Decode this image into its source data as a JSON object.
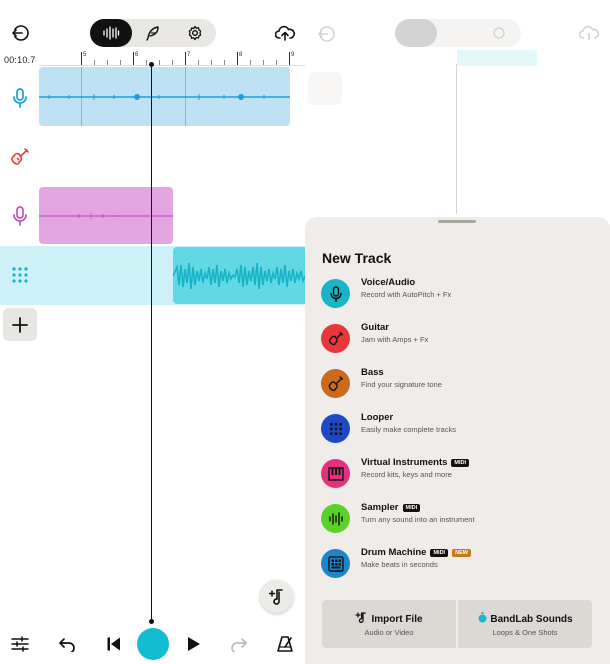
{
  "timeline": {
    "position": "00:10.7",
    "bars": [
      "5",
      "6",
      "7",
      "8",
      "9"
    ]
  },
  "toolbar": {
    "back_icon": "exit-icon",
    "segments": [
      "waveform-icon",
      "feather-icon",
      "gear-icon"
    ],
    "active_segment": "waveform-icon",
    "upload_icon": "cloud-upload-icon"
  },
  "tracks": [
    {
      "icon": "microphone-icon",
      "color": "#1a9fdc",
      "clip_color": "#bfe1f6"
    },
    {
      "icon": "guitar-icon",
      "color": "#ef3b3b",
      "clip_color": null
    },
    {
      "icon": "microphone-icon",
      "color": "#c454c4",
      "clip_color": "#e3a6e1"
    },
    {
      "icon": "looper-icon",
      "color": "#19b3c8",
      "clip_color": "#62d8e4"
    }
  ],
  "transport": {
    "mixer_icon": "sliders-icon",
    "undo_icon": "undo-icon",
    "skip_back_icon": "skip-back-icon",
    "record_color": "#12bcd3",
    "play_icon": "play-icon",
    "redo_icon": "redo-icon",
    "metronome_icon": "metronome-icon",
    "add_sound_icon": "add-music-icon"
  },
  "sheet": {
    "title": "New Track",
    "items": [
      {
        "title": "Voice/Audio",
        "subtitle": "Record with AutoPitch + Fx",
        "icon": "microphone-icon",
        "color": "#1ab4c8",
        "midi": "",
        "new": ""
      },
      {
        "title": "Guitar",
        "subtitle": "Jam with Amps + Fx",
        "icon": "guitar-icon",
        "color": "#e8373a",
        "midi": "",
        "new": ""
      },
      {
        "title": "Bass",
        "subtitle": "Find your signature tone",
        "icon": "bass-icon",
        "color": "#c96a1c",
        "midi": "",
        "new": ""
      },
      {
        "title": "Looper",
        "subtitle": "Easily make complete tracks",
        "icon": "looper-icon",
        "color": "#1d49c9",
        "midi": "",
        "new": ""
      },
      {
        "title": "Virtual Instruments",
        "subtitle": "Record kits, keys and more",
        "icon": "piano-icon",
        "color": "#e3317d",
        "midi": "MIDI",
        "new": ""
      },
      {
        "title": "Sampler",
        "subtitle": "Turn any sound into an instrument",
        "icon": "sampler-icon",
        "color": "#5ad12a",
        "midi": "MIDI",
        "new": ""
      },
      {
        "title": "Drum Machine",
        "subtitle": "Make beats in seconds",
        "icon": "drum-machine-icon",
        "color": "#1b86c9",
        "midi": "MIDI",
        "new": "NEW"
      }
    ],
    "import": {
      "title": "Import File",
      "subtitle": "Audio or Video",
      "icon": "import-file-icon"
    },
    "sounds": {
      "title": "BandLab Sounds",
      "subtitle": "Loops & One Shots",
      "icon": "bandlab-sounds-icon"
    }
  }
}
